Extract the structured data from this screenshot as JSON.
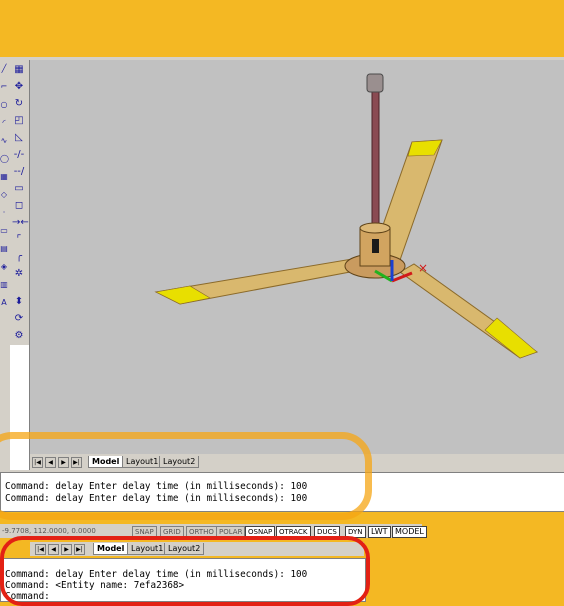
{
  "top_window": {
    "tabs": [
      "Model",
      "Layout1",
      "Layout2"
    ],
    "active_tab": "Model",
    "command_lines": [
      "Command: delay Enter delay time (in milliseconds): 100",
      "Command: delay Enter delay time (in milliseconds): 100"
    ]
  },
  "status_bar": {
    "coords": "-9.7708, 112.0000, 0.0000",
    "toggles": [
      "SNAP",
      "GRID",
      "ORTHO",
      "POLAR",
      "OSNAP",
      "OTRACK",
      "DUCS",
      "DYN",
      "LWT",
      "MODEL"
    ]
  },
  "bottom_window": {
    "tabs": [
      "Model",
      "Layout1",
      "Layout2"
    ],
    "active_tab": "Model",
    "command_lines": [
      "Command: delay Enter delay time (in milliseconds): 100",
      "Command: <Entity name: 7efa2368>",
      "Command:"
    ]
  },
  "icons": {
    "toolbar_draw": [
      "line-icon",
      "polyline-icon",
      "circle-icon",
      "arc-icon",
      "spline-icon",
      "ellipse-icon",
      "hatch-icon",
      "region-icon",
      "table-icon",
      "text-icon",
      "point-icon",
      "insert-icon"
    ],
    "toolbar_modify": [
      "select-icon",
      "move-icon",
      "rotate-icon",
      "scale-icon",
      "stretch-icon",
      "trim-icon",
      "extend-icon",
      "rectangle-icon",
      "break-icon",
      "join-icon",
      "chamfer-icon",
      "fillet-icon",
      "explode-icon"
    ],
    "nav_arrows": [
      "first-tab-icon",
      "prev-tab-icon",
      "next-tab-icon",
      "last-tab-icon"
    ]
  },
  "colors": {
    "background": "#f4b823",
    "viewport": "#c1c1c1",
    "blade": "#d9b86e",
    "blade_tip": "#e8df00",
    "rod": "#8a4a52",
    "highlight_orange": "#f6a614",
    "highlight_red": "#e32114"
  }
}
